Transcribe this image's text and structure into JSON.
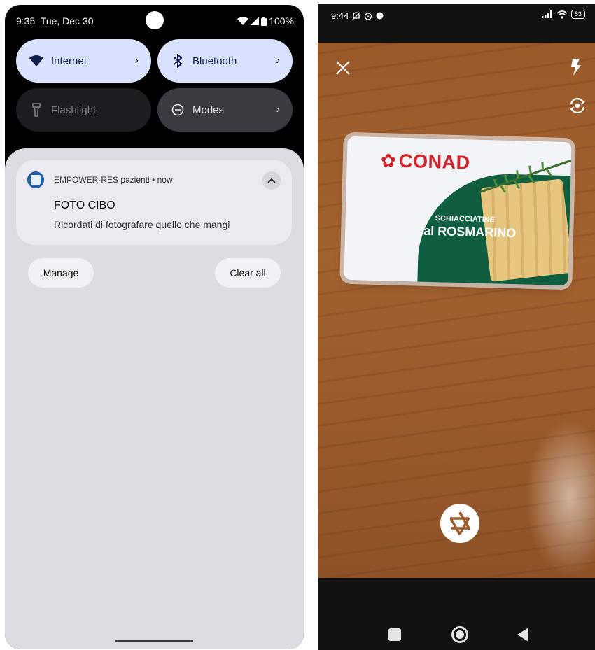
{
  "left": {
    "status": {
      "time": "9:35",
      "date": "Tue, Dec 30",
      "battery": "100%"
    },
    "quick_tiles": [
      {
        "label": "Internet",
        "icon": "wifi-icon",
        "state": "on"
      },
      {
        "label": "Bluetooth",
        "icon": "bluetooth-icon",
        "state": "on"
      },
      {
        "label": "Flashlight",
        "icon": "flashlight-icon",
        "state": "off"
      },
      {
        "label": "Modes",
        "icon": "modes-icon",
        "state": "neutral"
      }
    ],
    "notification": {
      "app_name": "EMPOWER-RES pazienti",
      "time_sep": "•",
      "time": "now",
      "title": "FOTO CIBO",
      "body": "Ricordati di fotografare quello che mangi"
    },
    "actions": {
      "manage": "Manage",
      "clear_all": "Clear all"
    }
  },
  "right": {
    "status": {
      "time": "9:44",
      "battery": "53"
    },
    "package": {
      "brand": "CONAD",
      "line1": "SCHIACCIATINE",
      "line2": "al ROSMARINO"
    },
    "colors": {
      "brand_red": "#d62128",
      "pack_green": "#0f5e3f",
      "tile_on": "#d8e2ff"
    }
  }
}
